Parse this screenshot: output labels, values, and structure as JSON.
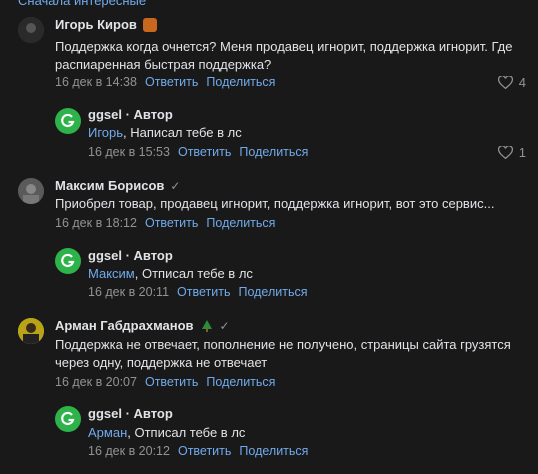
{
  "top_link": "Сначала интересные",
  "comments": [
    {
      "author": "Игорь Киров",
      "text": "Поддержка когда очнется? Меня продавец игнорит, поддержка игнорит. Где распиаренная быстрая поддержка?",
      "date": "16 дек в 14:38",
      "reply": "Ответить",
      "share": "Поделиться",
      "likes": "4"
    },
    {
      "author": "ggsel",
      "author_suffix": " · Автор",
      "mention": "Игорь",
      "text": ", Написал тебе в лс",
      "date": "16 дек в 15:53",
      "reply": "Ответить",
      "share": "Поделиться",
      "likes": "1"
    },
    {
      "author": "Максим Борисов",
      "text": "Приобрел товар, продавец игнорит, поддержка игнорит, вот это сервис...",
      "date": "16 дек в 18:12",
      "reply": "Ответить",
      "share": "Поделиться"
    },
    {
      "author": "ggsel",
      "author_suffix": " · Автор",
      "mention": "Максим",
      "text": ", Отписал тебе в лс",
      "date": "16 дек в 20:11",
      "reply": "Ответить",
      "share": "Поделиться"
    },
    {
      "author": "Арман Габдрахманов",
      "text": "Поддержка не отвечает, пополнение не получено, страницы сайта грузятся через одну, поддержка не отвечает",
      "date": "16 дек в 20:07",
      "reply": "Ответить",
      "share": "Поделиться"
    },
    {
      "author": "ggsel",
      "author_suffix": " · Автор",
      "mention": "Арман",
      "text": ", Отписал тебе в лс",
      "date": "16 дек в 20:12",
      "reply": "Ответить",
      "share": "Поделиться"
    }
  ],
  "colors": {
    "background": "#19191a",
    "link": "#71aaeb",
    "muted": "#939393",
    "brand": "#2db34a"
  }
}
